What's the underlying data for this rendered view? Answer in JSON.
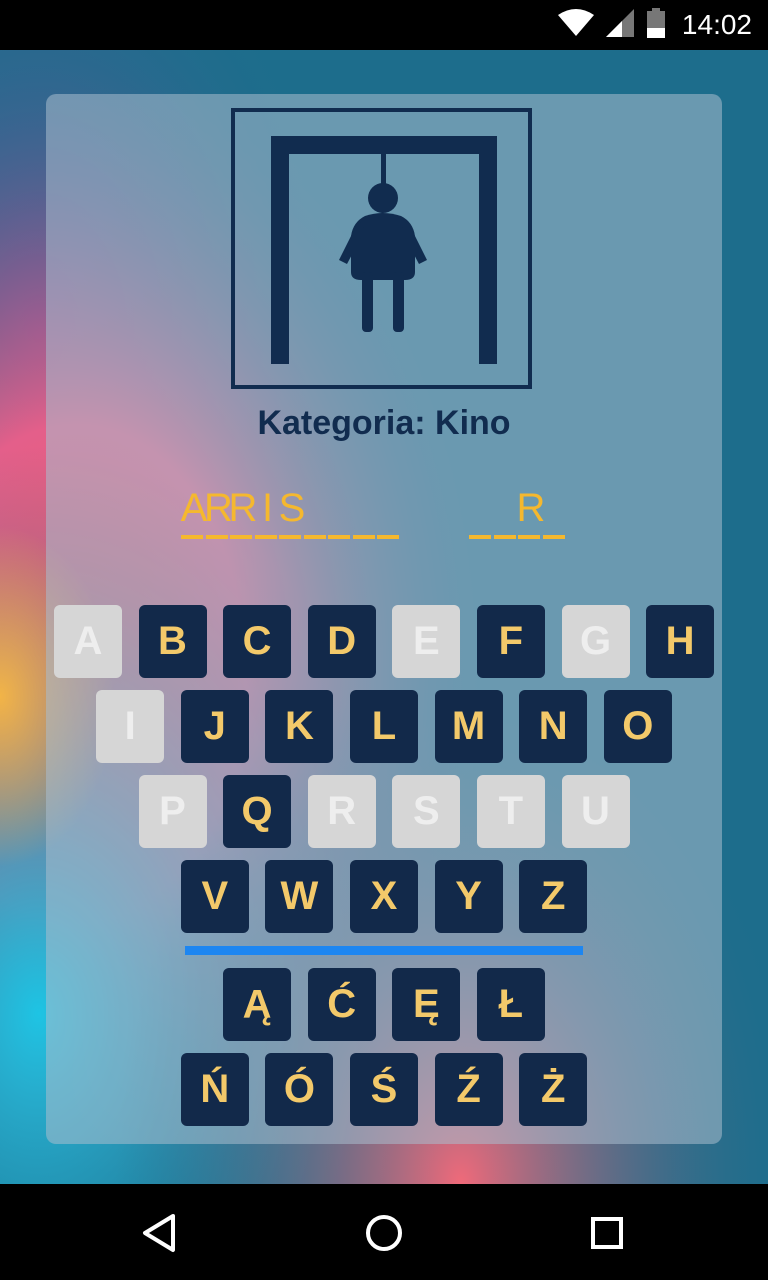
{
  "status_bar": {
    "time": "14:02",
    "icons": [
      "wifi-icon",
      "signal-icon",
      "battery-icon"
    ]
  },
  "game": {
    "category": "Kategoria: Kino",
    "word_groups": [
      [
        "A",
        "R",
        "R",
        "I",
        "S",
        "",
        "",
        "",
        ""
      ],
      [
        "",
        "",
        "R",
        ""
      ]
    ],
    "keyboard_rows": [
      [
        {
          "letter": "A",
          "used": true
        },
        {
          "letter": "B",
          "used": false
        },
        {
          "letter": "C",
          "used": false
        },
        {
          "letter": "D",
          "used": false
        },
        {
          "letter": "E",
          "used": true
        },
        {
          "letter": "F",
          "used": false
        },
        {
          "letter": "G",
          "used": true
        },
        {
          "letter": "H",
          "used": false
        }
      ],
      [
        {
          "letter": "I",
          "used": true
        },
        {
          "letter": "J",
          "used": false
        },
        {
          "letter": "K",
          "used": false
        },
        {
          "letter": "L",
          "used": false
        },
        {
          "letter": "M",
          "used": false
        },
        {
          "letter": "N",
          "used": false
        },
        {
          "letter": "O",
          "used": false
        }
      ],
      [
        {
          "letter": "P",
          "used": true
        },
        {
          "letter": "Q",
          "used": false
        },
        {
          "letter": "R",
          "used": true
        },
        {
          "letter": "S",
          "used": true
        },
        {
          "letter": "T",
          "used": true
        },
        {
          "letter": "U",
          "used": true
        }
      ],
      [
        {
          "letter": "V",
          "used": false
        },
        {
          "letter": "W",
          "used": false
        },
        {
          "letter": "X",
          "used": false
        },
        {
          "letter": "Y",
          "used": false
        },
        {
          "letter": "Z",
          "used": false
        }
      ],
      [
        {
          "letter": "Ą",
          "used": false
        },
        {
          "letter": "Ć",
          "used": false
        },
        {
          "letter": "Ę",
          "used": false
        },
        {
          "letter": "Ł",
          "used": false
        }
      ],
      [
        {
          "letter": "Ń",
          "used": false
        },
        {
          "letter": "Ó",
          "used": false
        },
        {
          "letter": "Ś",
          "used": false
        },
        {
          "letter": "Ź",
          "used": false
        },
        {
          "letter": "Ż",
          "used": false
        }
      ]
    ]
  },
  "colors": {
    "key_active_bg": "#12294a",
    "key_active_text": "#f3c96a",
    "key_used_bg": "#d6d6d6",
    "word_color": "#f5b82e",
    "divider": "#1d86f1",
    "title_color": "#112c4f"
  },
  "nav_bar": {
    "icons": [
      "back-icon",
      "home-icon",
      "recents-icon"
    ]
  }
}
